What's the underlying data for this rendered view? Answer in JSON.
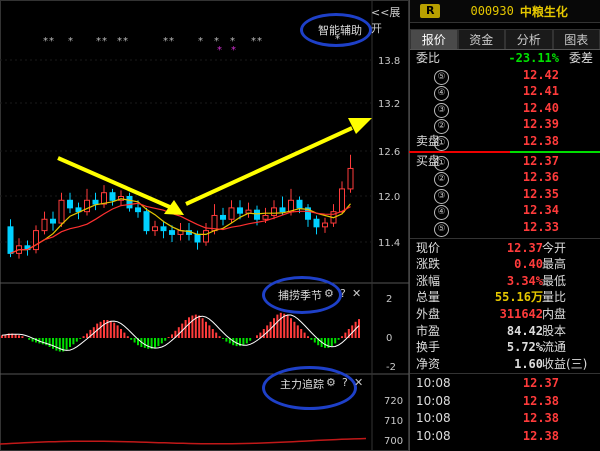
{
  "chart_area": {
    "collapse_button": "<<展开",
    "smart_assist_label": "智能辅助",
    "smart_assist_star": "*",
    "price_axis": [
      "13.8",
      "13.2",
      "12.6",
      "12.0",
      "11.4"
    ],
    "indicator1_label": "捕捞季节",
    "indicator1_axis": [
      "2",
      "0",
      "-2"
    ],
    "indicator2_label": "主力追踪",
    "indicator2_axis": [
      "720",
      "710",
      "700"
    ],
    "stars": "** * ** ** ** * * * **",
    "gear_icon_text": "⚙",
    "help_text": "?",
    "close_text": "✕",
    "colors": {
      "up": "#ff3b3b",
      "down": "#00d0ff",
      "ma_yellow": "#e5c700",
      "ma_red": "#ff3030",
      "highlight": "#1e40c8",
      "arrow": "#ffff00"
    }
  },
  "stock": {
    "badge": "R",
    "code": "000930",
    "name": "中粮生化"
  },
  "tabs": [
    "报价",
    "资金",
    "分析",
    "图表"
  ],
  "weibi": {
    "label": "委比",
    "value": "-23.11%",
    "right": "委差"
  },
  "sell": [
    {
      "lvl": "⑤",
      "price": "12.42"
    },
    {
      "lvl": "④",
      "price": "12.41"
    },
    {
      "lvl": "③",
      "price": "12.40"
    },
    {
      "lvl": "②",
      "price": "12.39"
    },
    {
      "lvl": "①",
      "price": "12.38",
      "label": "卖盘"
    }
  ],
  "buy": [
    {
      "lvl": "①",
      "price": "12.37",
      "label": "买盘"
    },
    {
      "lvl": "②",
      "price": "12.36"
    },
    {
      "lvl": "③",
      "price": "12.35"
    },
    {
      "lvl": "④",
      "price": "12.34"
    },
    {
      "lvl": "⑤",
      "price": "12.33"
    }
  ],
  "quote": [
    {
      "l": "现价",
      "v": "12.37",
      "r": "今开",
      "vc": "#ff3b3b"
    },
    {
      "l": "涨跌",
      "v": "0.40",
      "r": "最高",
      "vc": "#ff3b3b"
    },
    {
      "l": "涨幅",
      "v": "3.34%",
      "r": "最低",
      "vc": "#ff3b3b"
    },
    {
      "l": "总量",
      "v": "55.16万",
      "r": "量比",
      "vc": "#e5c700"
    },
    {
      "l": "外盘",
      "v": "311642",
      "r": "内盘",
      "vc": "#ff3b3b"
    },
    {
      "l": "市盈",
      "v": "84.42",
      "r": "股本",
      "vc": "#ddd"
    },
    {
      "l": "换手",
      "v": "5.72%",
      "r": "流通",
      "vc": "#ddd"
    },
    {
      "l": "净资",
      "v": "1.60",
      "r": "收益(三)",
      "vc": "#ddd"
    }
  ],
  "ticks": [
    {
      "t": "10:08",
      "p": "12.37"
    },
    {
      "t": "10:08",
      "p": "12.38"
    },
    {
      "t": "10:08",
      "p": "12.38"
    },
    {
      "t": "10:08",
      "p": "12.38"
    }
  ]
}
